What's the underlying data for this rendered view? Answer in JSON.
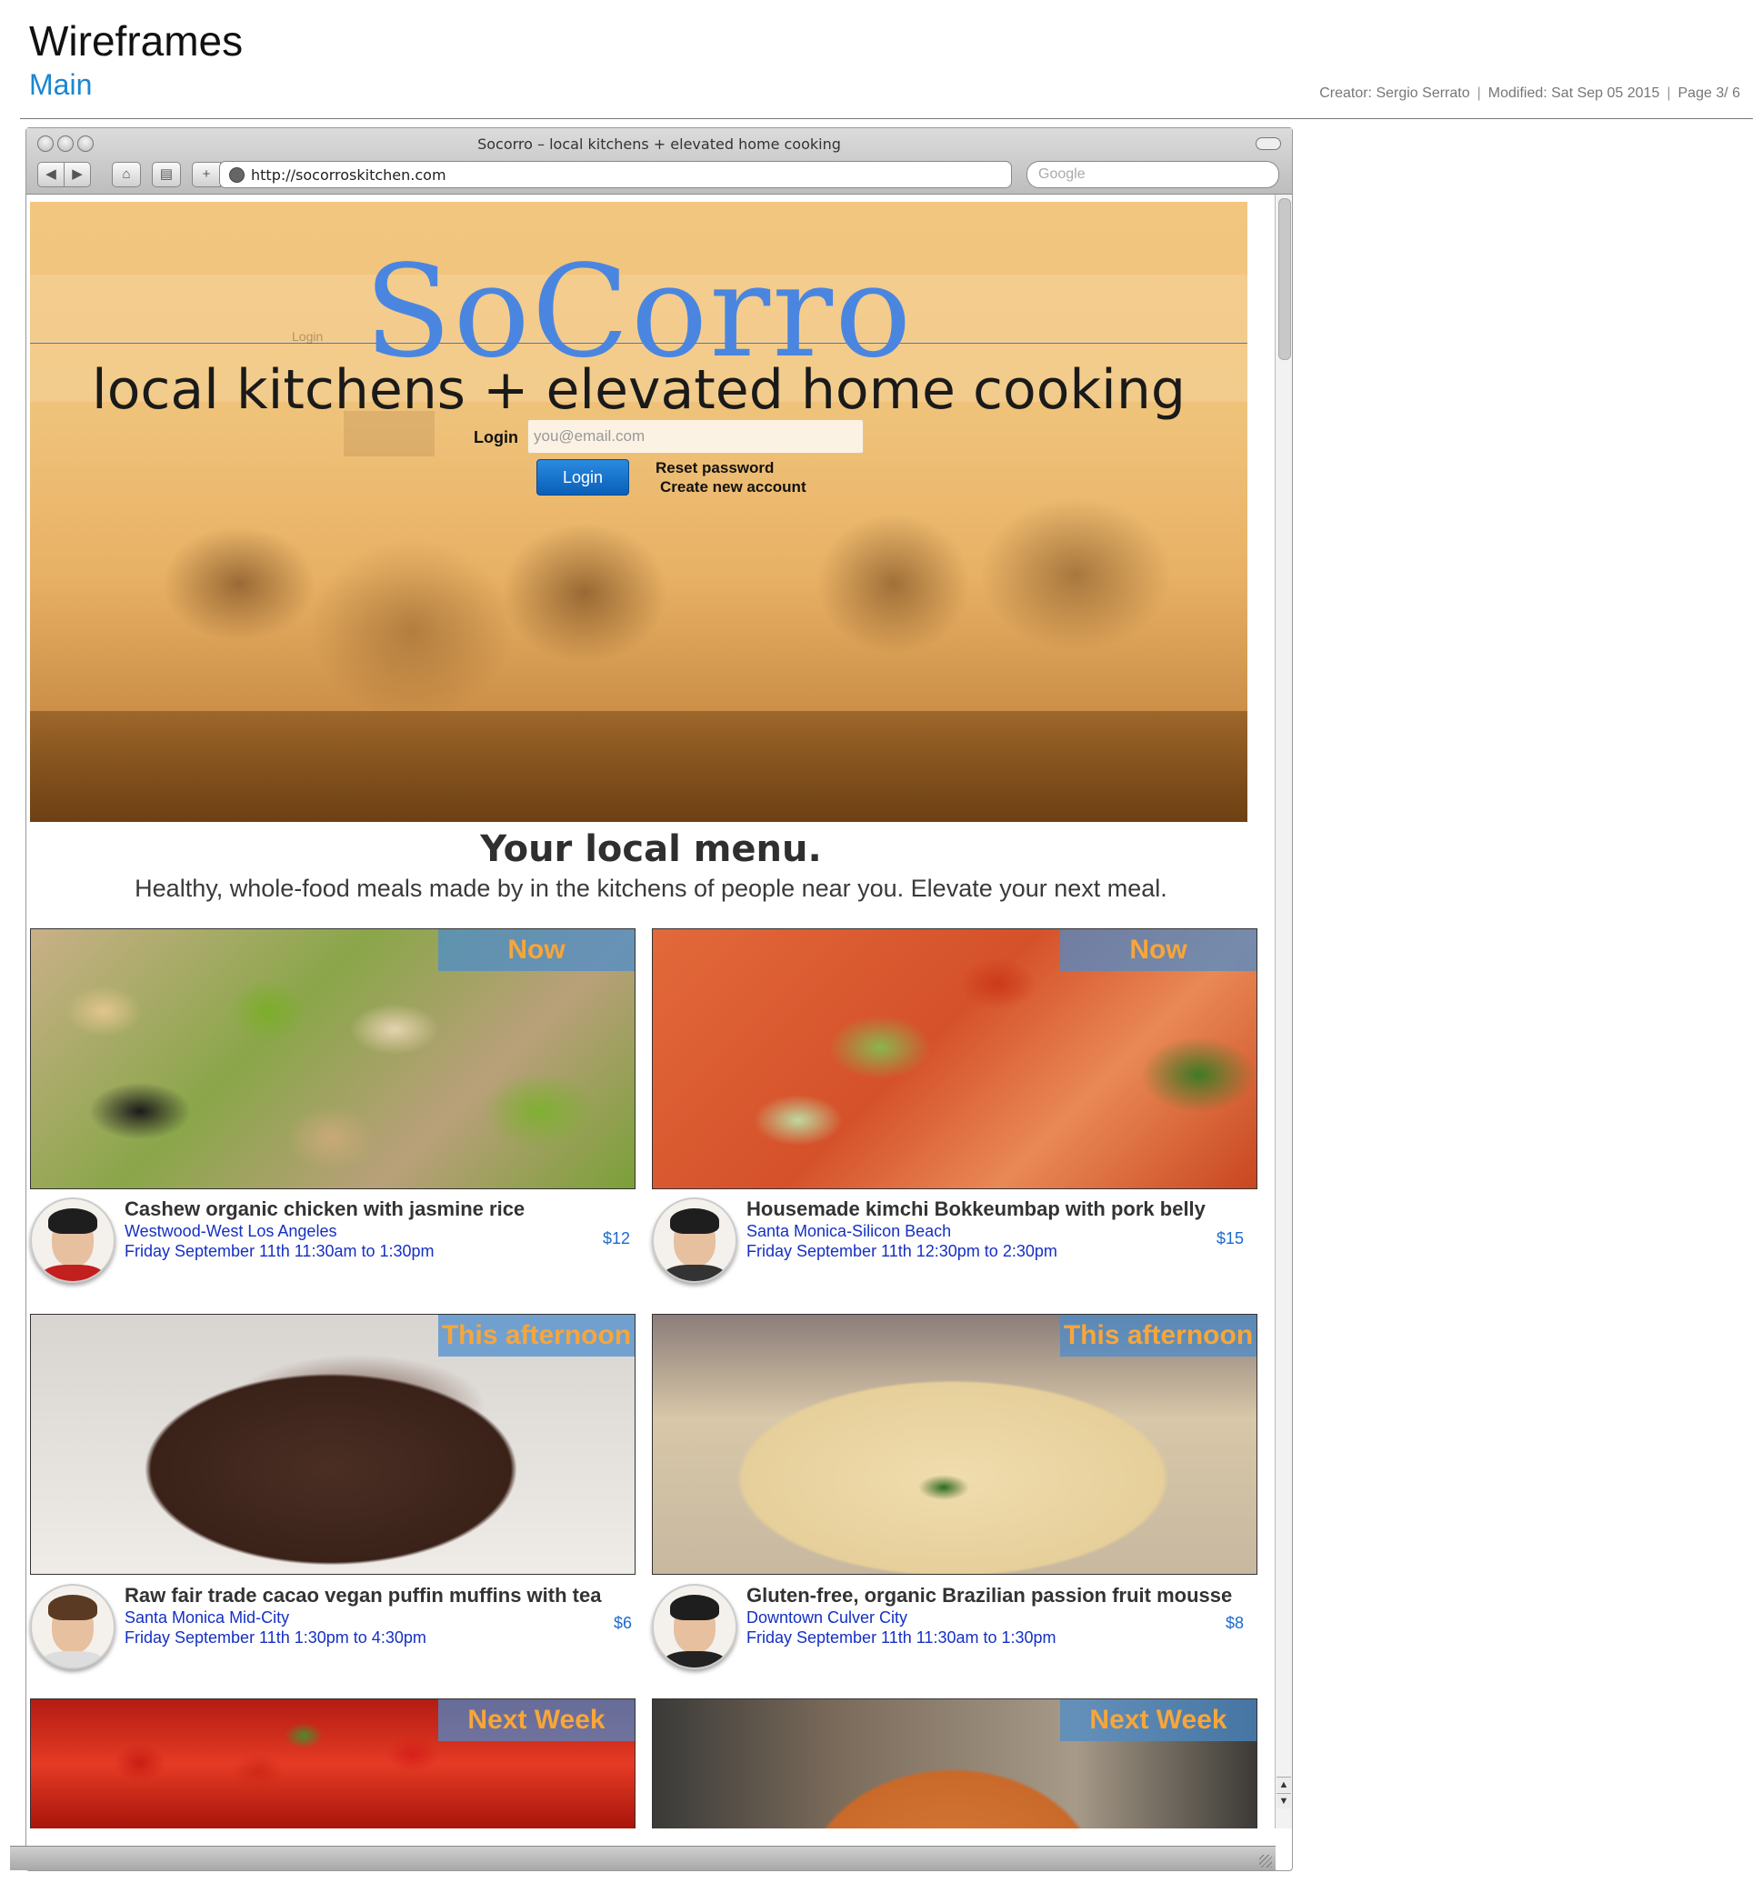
{
  "doc": {
    "title": "Wireframes",
    "subtitle": "Main",
    "creator": "Creator: Sergio Serrato",
    "modified": "Modified: Sat Sep 05 2015",
    "page": "Page 3/ 6"
  },
  "browser": {
    "window_title": "Socorro – local kitchens + elevated home cooking",
    "url": "http://socorroskitchen.com",
    "search_placeholder": "Google"
  },
  "hero": {
    "brand": "SoCorro",
    "tagline": "local kitchens + elevated home cooking",
    "ghost_login": "Login",
    "login_label": "Login",
    "email_placeholder": "you@email.com",
    "login_button": "Login",
    "reset_link": "Reset password",
    "create_link": "Create new account"
  },
  "section": {
    "title": "Your local menu.",
    "subtitle": "Healthy, whole-food meals made by in the kitchens of people near you. Elevate your next meal."
  },
  "cards": [
    {
      "badge": "Now",
      "title": "Cashew organic chicken with jasmine rice",
      "area": "Westwood-West Los Angeles",
      "time": "Friday September 11th 11:30am to 1:30pm",
      "price": "$12"
    },
    {
      "badge": "Now",
      "title": "Housemade kimchi Bokkeumbap with pork belly",
      "area": "Santa Monica-Silicon Beach",
      "time": "Friday September 11th 12:30pm to 2:30pm",
      "price": "$15"
    },
    {
      "badge": "This afternoon",
      "title": "Raw fair trade cacao vegan puffin muffins with tea",
      "area": "Santa Monica Mid-City",
      "time": "Friday September 11th 1:30pm to 4:30pm",
      "price": "$6"
    },
    {
      "badge": "This afternoon",
      "title": "Gluten-free, organic Brazilian passion fruit mousse",
      "area": "Downtown Culver City",
      "time": "Friday September 11th 11:30am to 1:30pm",
      "price": "$8"
    },
    {
      "badge": "Next Week"
    },
    {
      "badge": "Next Week"
    }
  ]
}
